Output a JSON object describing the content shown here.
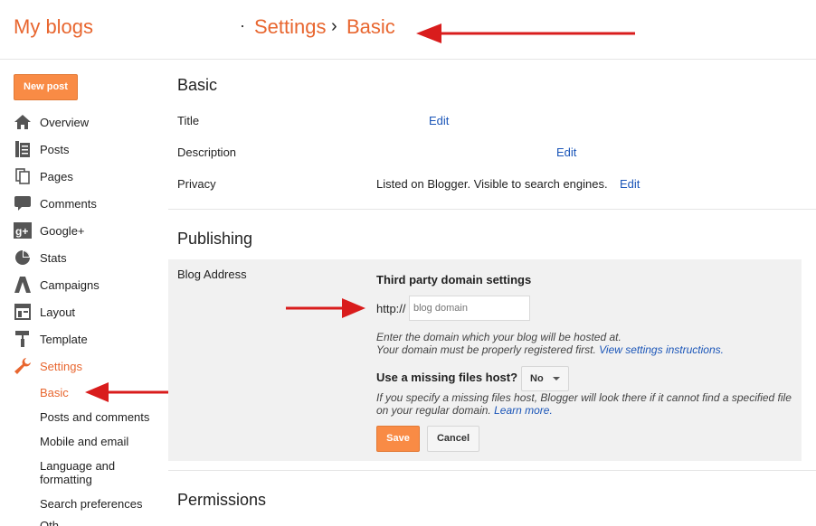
{
  "header": {
    "app_title": "My blogs",
    "breadcrumb_dot": "·",
    "breadcrumb_settings": "Settings",
    "breadcrumb_sep": "›",
    "breadcrumb_basic": "Basic"
  },
  "sidebar": {
    "new_post_label": "New post",
    "items": [
      {
        "label": "Overview",
        "icon": "home-icon"
      },
      {
        "label": "Posts",
        "icon": "posts-icon"
      },
      {
        "label": "Pages",
        "icon": "pages-icon"
      },
      {
        "label": "Comments",
        "icon": "comment-icon"
      },
      {
        "label": "Google+",
        "icon": "google-plus-icon"
      },
      {
        "label": "Stats",
        "icon": "pie-chart-icon"
      },
      {
        "label": "Campaigns",
        "icon": "campaigns-icon"
      },
      {
        "label": "Layout",
        "icon": "layout-icon"
      },
      {
        "label": "Template",
        "icon": "paint-roller-icon"
      },
      {
        "label": "Settings",
        "icon": "wrench-icon"
      }
    ],
    "sub_items": [
      "Basic",
      "Posts and comments",
      "Mobile and email",
      "Language and formatting",
      "Search preferences",
      "Oth"
    ]
  },
  "basic": {
    "title": "Basic",
    "title_label": "Title",
    "description_label": "Description",
    "privacy_label": "Privacy",
    "privacy_value": "Listed on Blogger. Visible to search engines.",
    "edit_label": "Edit"
  },
  "publishing": {
    "title": "Publishing",
    "blog_address_label": "Blog Address",
    "third_party_heading": "Third party domain settings",
    "http_prefix": "http://",
    "domain_placeholder": "blog domain",
    "help_line1": "Enter the domain which your blog will be hosted at.",
    "help_line2": "Your domain must be properly registered first.",
    "help_link": "View settings instructions.",
    "missing_host_label": "Use a missing files host?",
    "missing_host_value": "No",
    "missing_help_line1": "If you specify a missing files host, Blogger will look there if it cannot find a specified file",
    "missing_help_line2": "on your regular domain.",
    "learn_more": "Learn more.",
    "save_label": "Save",
    "cancel_label": "Cancel"
  },
  "permissions": {
    "title": "Permissions"
  },
  "colors": {
    "accent": "#e8662f",
    "button_orange": "#f98b45",
    "link_blue": "#1a55b8",
    "annotation_arrow": "#d91c1c"
  }
}
